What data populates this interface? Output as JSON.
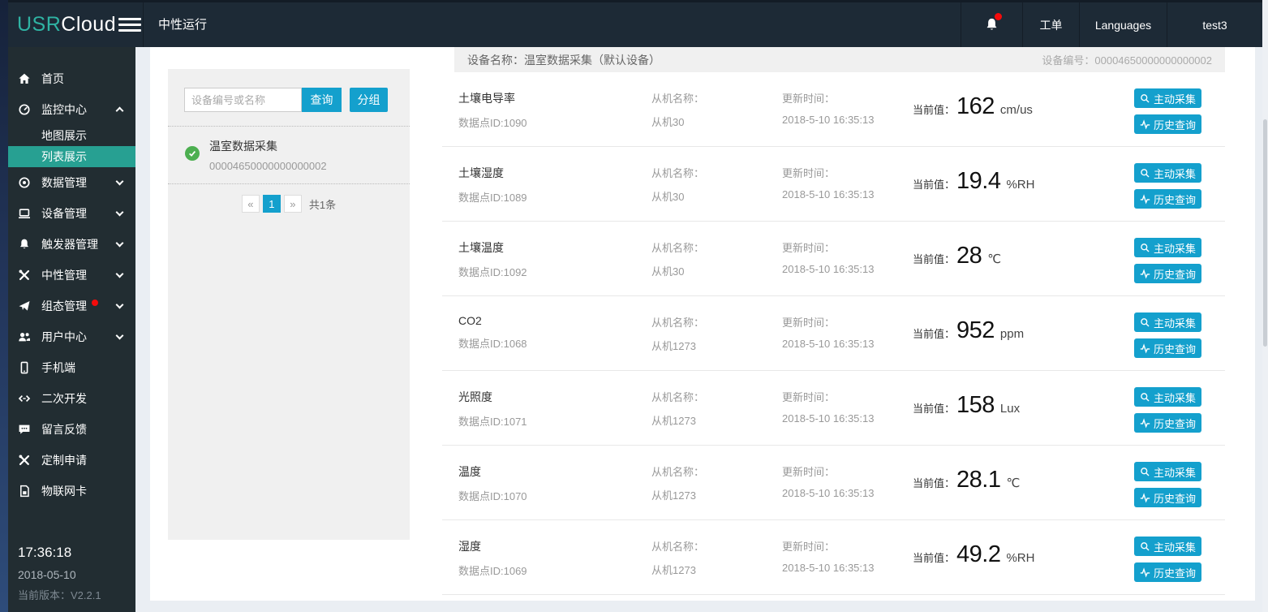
{
  "colors": {
    "accent_blue": "#14a0cd",
    "selected_teal": "#27a092",
    "logo_teal": "#2fb3a3",
    "status_green": "#4caf50",
    "alert_red": "#f40b0b",
    "topbar_bg": "#1d2a36",
    "sidebar_bg": "#222d32"
  },
  "topbar": {
    "logo_usr": "USR",
    "logo_cloud": "Cloud",
    "title": "中性运行",
    "work_order": "工单",
    "languages": "Languages",
    "username": "test3",
    "bell_icon": "bell-icon"
  },
  "sidebar": {
    "items": [
      {
        "label": "首页",
        "icon": "home-icon"
      },
      {
        "label": "监控中心",
        "icon": "gauge-icon",
        "chevron": "up"
      },
      {
        "label": "地图展示",
        "sub": true
      },
      {
        "label": "列表展示",
        "sub": true,
        "selected": true
      },
      {
        "label": "数据管理",
        "icon": "target-icon",
        "chevron": "down"
      },
      {
        "label": "设备管理",
        "icon": "laptop-icon",
        "chevron": "down"
      },
      {
        "label": "触发器管理",
        "icon": "bell-icon",
        "chevron": "down"
      },
      {
        "label": "中性管理",
        "icon": "tools-icon",
        "chevron": "down"
      },
      {
        "label": "组态管理",
        "icon": "paper-plane-icon",
        "chevron": "down",
        "badge": true
      },
      {
        "label": "用户中心",
        "icon": "users-icon",
        "chevron": "down"
      },
      {
        "label": "手机端",
        "icon": "mobile-icon"
      },
      {
        "label": "二次开发",
        "icon": "code-icon"
      },
      {
        "label": "留言反馈",
        "icon": "comment-icon"
      },
      {
        "label": "定制申请",
        "icon": "tools-icon"
      },
      {
        "label": "物联网卡",
        "icon": "sim-card-icon"
      }
    ],
    "clock": {
      "time": "17:36:18",
      "date": "2018-05-10",
      "version": "当前版本：V2.2.1"
    }
  },
  "device_panel": {
    "search_placeholder": "设备编号或名称",
    "search_button": "查询",
    "group_button": "分组",
    "device": {
      "status_icon": "check-circle-icon",
      "name": "温室数据采集",
      "id": "00004650000000000002"
    },
    "pagination": {
      "prev": "«",
      "current": "1",
      "next": "»",
      "total": "共1条"
    }
  },
  "main": {
    "header": {
      "name_label": "设备名称：温室数据采集（默认设备）",
      "id_label": "设备编号：00004650000000000002"
    },
    "buttons": {
      "collect": "主动采集",
      "history": "历史查询"
    },
    "rows": [
      {
        "name": "土壤电导率",
        "point_id": "数据点ID:1090",
        "slave_label": "从机名称：",
        "slave": "从机30",
        "time_label": "更新时间：",
        "time": "2018-5-10 16:35:13",
        "value_label": "当前值：",
        "value": "162",
        "unit": "cm/us"
      },
      {
        "name": "土壤湿度",
        "point_id": "数据点ID:1089",
        "slave_label": "从机名称：",
        "slave": "从机30",
        "time_label": "更新时间：",
        "time": "2018-5-10 16:35:13",
        "value_label": "当前值：",
        "value": "19.4",
        "unit": "%RH"
      },
      {
        "name": "土壤温度",
        "point_id": "数据点ID:1092",
        "slave_label": "从机名称：",
        "slave": "从机30",
        "time_label": "更新时间：",
        "time": "2018-5-10 16:35:13",
        "value_label": "当前值：",
        "value": "28",
        "unit": "℃"
      },
      {
        "name": "CO2",
        "point_id": "数据点ID:1068",
        "slave_label": "从机名称：",
        "slave": "从机1273",
        "time_label": "更新时间：",
        "time": "2018-5-10 16:35:13",
        "value_label": "当前值：",
        "value": "952",
        "unit": "ppm"
      },
      {
        "name": "光照度",
        "point_id": "数据点ID:1071",
        "slave_label": "从机名称：",
        "slave": "从机1273",
        "time_label": "更新时间：",
        "time": "2018-5-10 16:35:13",
        "value_label": "当前值：",
        "value": "158",
        "unit": "Lux"
      },
      {
        "name": "温度",
        "point_id": "数据点ID:1070",
        "slave_label": "从机名称：",
        "slave": "从机1273",
        "time_label": "更新时间：",
        "time": "2018-5-10 16:35:13",
        "value_label": "当前值：",
        "value": "28.1",
        "unit": "℃"
      },
      {
        "name": "湿度",
        "point_id": "数据点ID:1069",
        "slave_label": "从机名称：",
        "slave": "从机1273",
        "time_label": "更新时间：",
        "time": "2018-5-10 16:35:13",
        "value_label": "当前值：",
        "value": "49.2",
        "unit": "%RH"
      }
    ]
  }
}
